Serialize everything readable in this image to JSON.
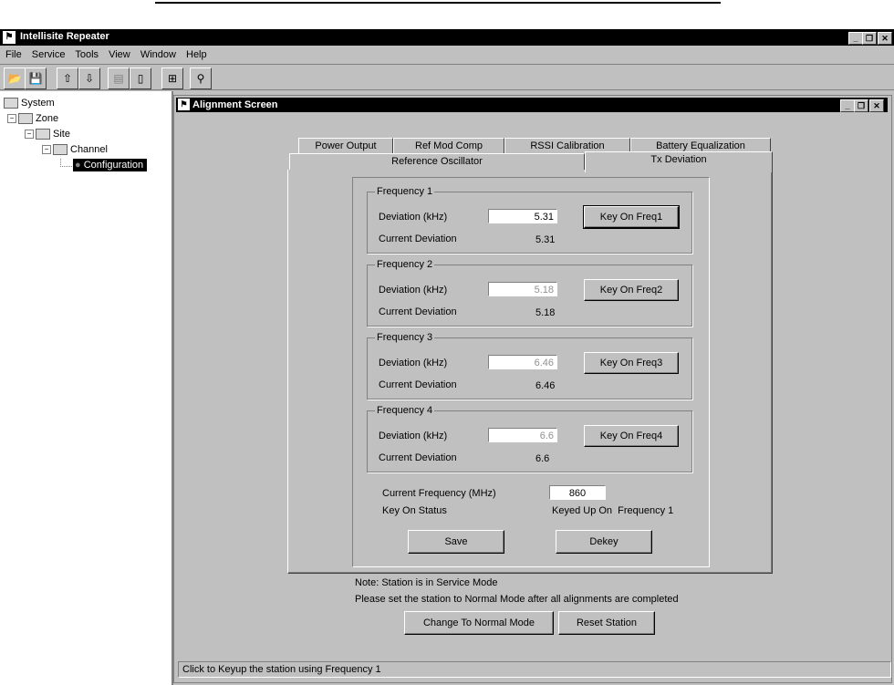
{
  "app": {
    "title": "Intellisite Repeater"
  },
  "menu": [
    "File",
    "Service",
    "Tools",
    "View",
    "Window",
    "Help"
  ],
  "tree": {
    "system": "System",
    "zone": "Zone",
    "site": "Site",
    "channel": "Channel",
    "configuration": "Configuration"
  },
  "alignment": {
    "title": "Alignment Screen",
    "tabs_back": [
      "Power Output",
      "Ref Mod Comp",
      "RSSI Calibration",
      "Battery Equalization"
    ],
    "tabs_front": [
      "Reference Oscillator",
      "Tx Deviation"
    ],
    "active_tab": "Tx Deviation",
    "frequencies": [
      {
        "legend": "Frequency 1",
        "deviation_label": "Deviation (kHz)",
        "deviation_value": "5.31",
        "current_label": "Current Deviation",
        "current_value": "5.31",
        "button": "Key On Freq1"
      },
      {
        "legend": "Frequency 2",
        "deviation_label": "Deviation (kHz)",
        "deviation_value": "5.18",
        "current_label": "Current Deviation",
        "current_value": "5.18",
        "button": "Key On Freq2"
      },
      {
        "legend": "Frequency 3",
        "deviation_label": "Deviation (kHz)",
        "deviation_value": "6.46",
        "current_label": "Current Deviation",
        "current_value": "6.46",
        "button": "Key On Freq3"
      },
      {
        "legend": "Frequency 4",
        "deviation_label": "Deviation (kHz)",
        "deviation_value": "6.6",
        "current_label": "Current Deviation",
        "current_value": "6.6",
        "button": "Key On Freq4"
      }
    ],
    "current_frequency_label": "Current Frequency (MHz)",
    "current_frequency_value": "860",
    "key_on_status_label": "Key On Status",
    "key_on_status_value": "Keyed Up On  Frequency 1",
    "save_button": "Save",
    "dekey_button": "Dekey",
    "note_line1": "Note: Station is in Service Mode",
    "note_line2": "Please set the station to Normal Mode after all alignments are completed",
    "normal_mode_button": "Change To Normal Mode",
    "reset_button": "Reset Station",
    "status_bar": "Click to Keyup the station using Frequency 1"
  }
}
